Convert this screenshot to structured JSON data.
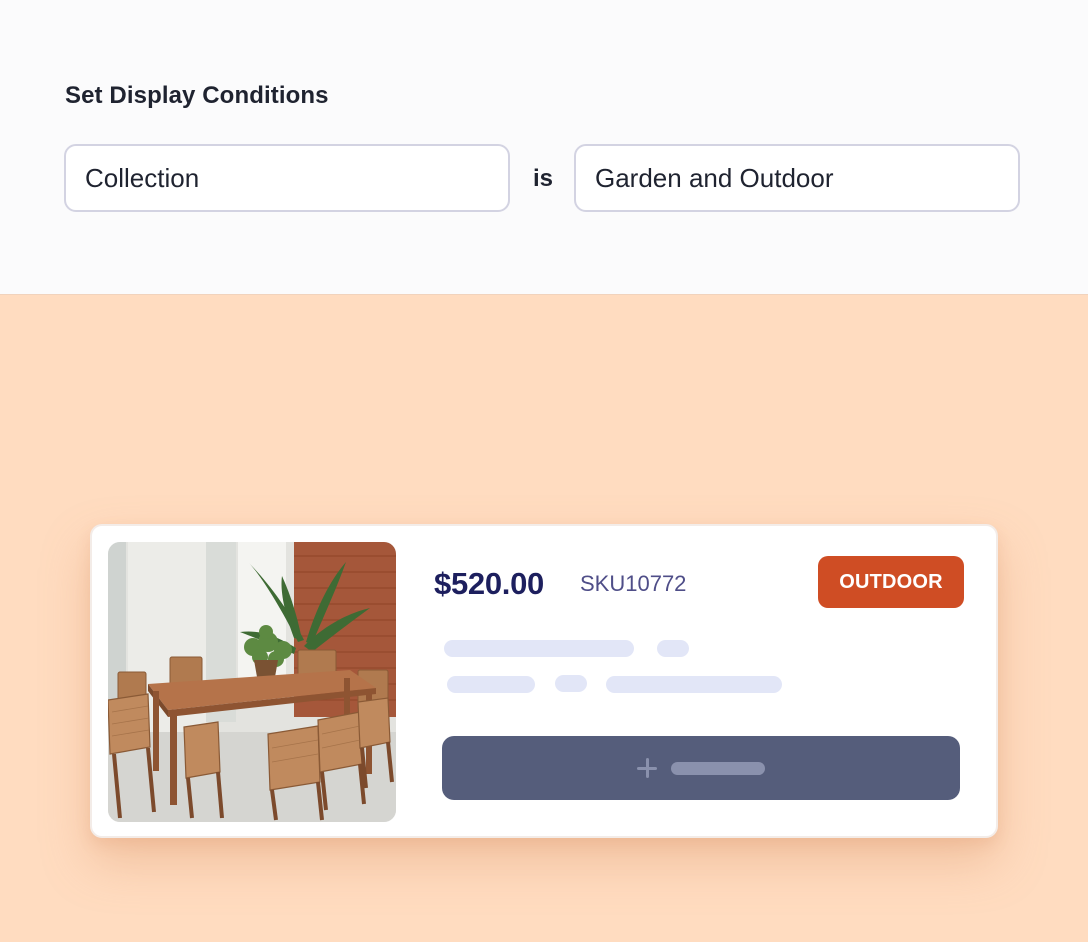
{
  "conditions": {
    "title": "Set Display Conditions",
    "field_value": "Collection",
    "operator": "is",
    "collection_value": "Garden and Outdoor"
  },
  "product": {
    "price": "$520.00",
    "sku": "SKU10772",
    "badge": "OUTDOOR",
    "image_icon": "outdoor-dining-set-photo",
    "add_icon": "plus-icon"
  },
  "colors": {
    "page_background": "#ffdcc0",
    "badge": "#cf4d24",
    "button": "#555d7b",
    "price": "#1d1f5e"
  }
}
